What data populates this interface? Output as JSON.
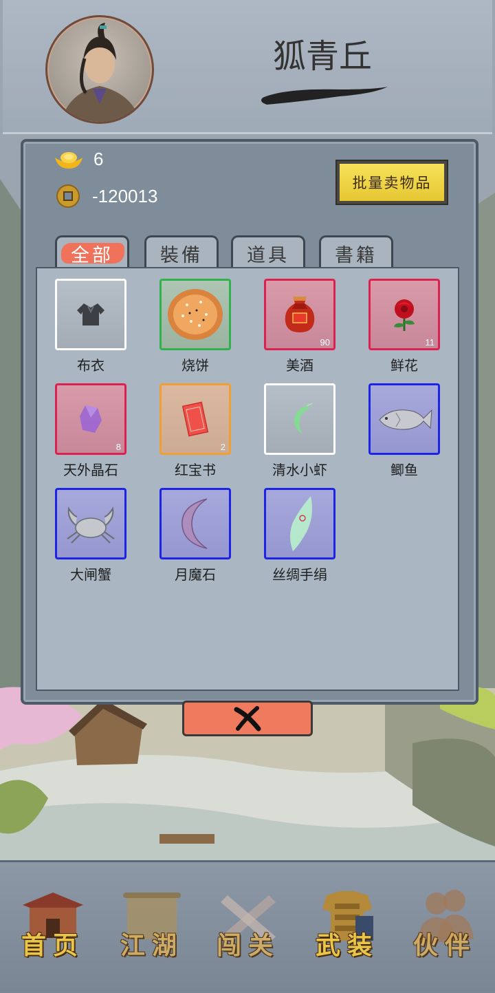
{
  "header": {
    "player_name": "狐青丘"
  },
  "resources": {
    "gold_ingots": "6",
    "copper_coins": "-120013"
  },
  "batch_sell_label": "批量卖物品",
  "tabs": [
    {
      "label": "全部",
      "active": true
    },
    {
      "label": "裝備",
      "active": false
    },
    {
      "label": "道具",
      "active": false
    },
    {
      "label": "書籍",
      "active": false
    }
  ],
  "items": [
    {
      "name": "布衣",
      "count": "",
      "quality": "white",
      "icon": "cloth-shirt-icon"
    },
    {
      "name": "烧饼",
      "count": "",
      "quality": "green",
      "icon": "sesame-cake-icon"
    },
    {
      "name": "美酒",
      "count": "90",
      "quality": "red",
      "icon": "wine-jar-icon"
    },
    {
      "name": "鲜花",
      "count": "11",
      "quality": "red",
      "icon": "rose-icon"
    },
    {
      "name": "天外晶石",
      "count": "8",
      "quality": "red",
      "icon": "crystal-icon"
    },
    {
      "name": "红宝书",
      "count": "2",
      "quality": "orange",
      "icon": "red-book-icon"
    },
    {
      "name": "清水小虾",
      "count": "",
      "quality": "white",
      "icon": "shrimp-icon"
    },
    {
      "name": "鲫鱼",
      "count": "",
      "quality": "blue",
      "icon": "fish-icon"
    },
    {
      "name": "大闸蟹",
      "count": "",
      "quality": "blue",
      "icon": "crab-icon"
    },
    {
      "name": "月魔石",
      "count": "",
      "quality": "blue",
      "icon": "moon-stone-icon"
    },
    {
      "name": "丝绸手绢",
      "count": "",
      "quality": "blue",
      "icon": "silk-handkerchief-icon"
    }
  ],
  "nav": [
    {
      "label": "首页",
      "icon": "home-pavilion-icon"
    },
    {
      "label": "江湖",
      "icon": "scroll-icon"
    },
    {
      "label": "闯关",
      "icon": "crossed-blades-icon"
    },
    {
      "label": "武装",
      "icon": "armor-icon"
    },
    {
      "label": "伙伴",
      "icon": "companions-icon"
    }
  ],
  "colors": {
    "quality_white": "#ffffff",
    "quality_green": "#2fb14c",
    "quality_red": "#dc2151",
    "quality_orange": "#f0a033",
    "quality_blue": "#1c22e6",
    "accent_tab": "#f0725a",
    "gold_button": "#f6e25a"
  }
}
